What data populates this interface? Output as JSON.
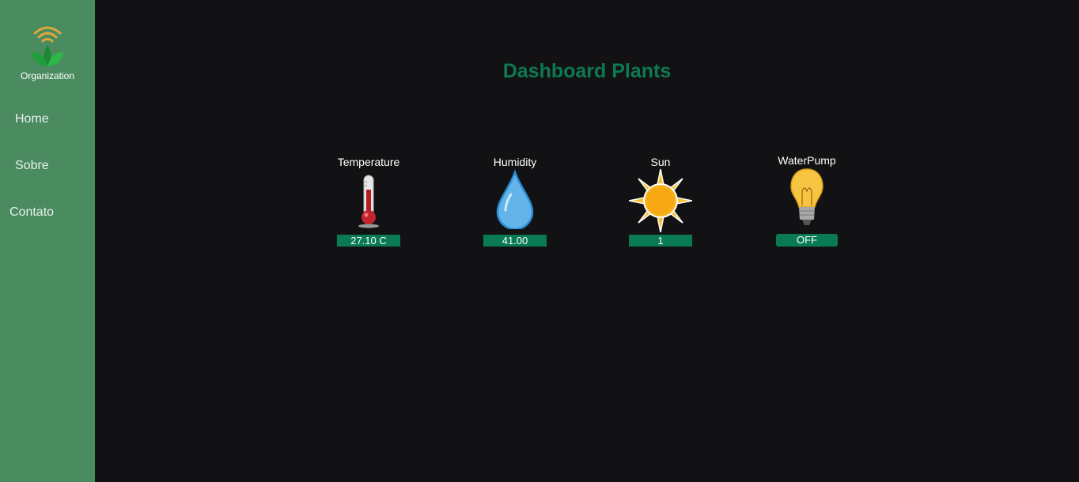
{
  "sidebar": {
    "logo_text": "Organization",
    "items": [
      {
        "label": "Home"
      },
      {
        "label": "Sobre"
      },
      {
        "label": "Contato"
      }
    ]
  },
  "main": {
    "title": "Dashboard Plants",
    "sensors": [
      {
        "label": "Temperature",
        "value": "27.10 C",
        "icon": "thermometer-icon"
      },
      {
        "label": "Humidity",
        "value": "41.00",
        "icon": "water-drop-icon"
      },
      {
        "label": "Sun",
        "value": "1",
        "icon": "sun-icon"
      },
      {
        "label": "WaterPump",
        "value": "OFF",
        "icon": "light-bulb-icon"
      }
    ]
  },
  "colors": {
    "sidebar_bg": "#4b8b60",
    "page_bg": "#121214",
    "title": "#0c7a4f",
    "value_badge": "#0a7a55"
  }
}
